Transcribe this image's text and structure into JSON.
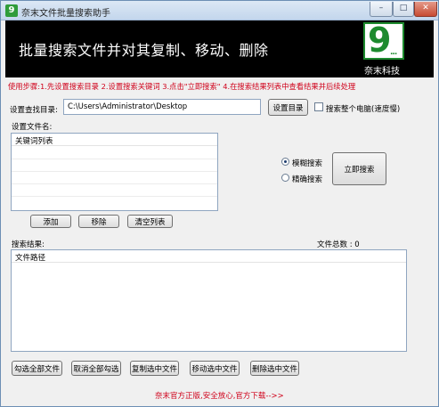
{
  "window": {
    "title": "奈末文件批量搜索助手",
    "icon_letter": "9",
    "minimize_glyph": "–",
    "maximize_glyph": "□",
    "close_glyph": "✕"
  },
  "banner": {
    "headline": "批量搜索文件并对其复制、移动、删除",
    "logo_glyph": "9",
    "logo_dots": "...",
    "company": "奈末科技"
  },
  "instructions": "使用步骤:1.先设置搜索目录 2.设置搜索关键词 3.点击\"立即搜索\" 4.在搜索结果列表中查看结果并后续处理",
  "directory": {
    "label": "设置查找目录:",
    "value": "C:\\Users\\Administrator\\Desktop",
    "set_button": "设置目录",
    "whole_computer_label": "搜索整个电脑(速度慢)"
  },
  "filename_section": {
    "label": "设置文件名:",
    "list_header": "关键词列表",
    "add_button": "添加",
    "remove_button": "移除",
    "clear_button": "清空列表"
  },
  "search_mode": {
    "fuzzy_label": "模糊搜索",
    "exact_label": "精确搜索",
    "search_button": "立即搜索"
  },
  "results": {
    "label": "搜索结果:",
    "total_label": "文件总数 : 0",
    "list_header": "文件路径"
  },
  "actions": {
    "select_all": "勾选全部文件",
    "deselect_all": "取消全部勾选",
    "copy_selected": "复制选中文件",
    "move_selected": "移动选中文件",
    "delete_selected": "删除选中文件"
  },
  "footer": "奈末官方正版,安全放心,官方下载-->>",
  "colors": {
    "accent_red": "#d0021b",
    "logo_green": "#1d8a2e",
    "banner_bg": "#000000"
  }
}
